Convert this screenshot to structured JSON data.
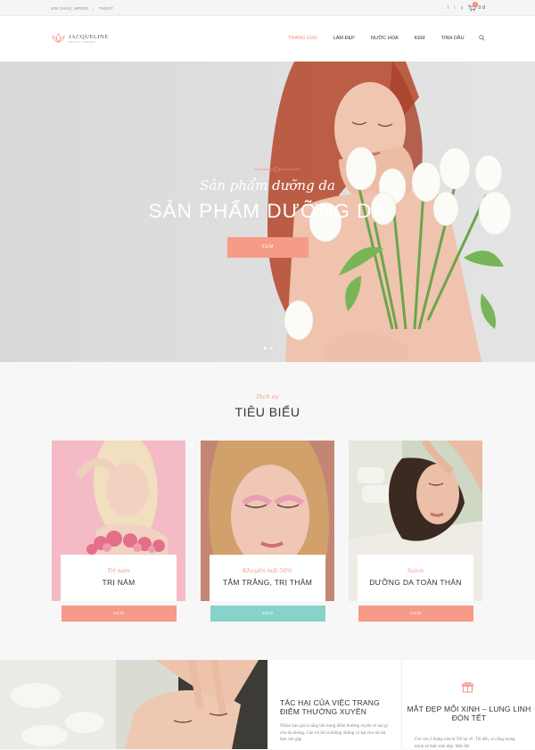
{
  "topbar": {
    "greeting": "XIN CHÀO, MP002",
    "logout": "THOÁT",
    "social_icons": [
      "facebook-icon",
      "twitter-icon",
      "pinterest-icon"
    ],
    "social_glyphs": [
      "f",
      "t",
      "p"
    ],
    "cart_count": "0",
    "cart_total": "0 đ"
  },
  "header": {
    "brand": "JACQUELINE",
    "tagline": "BEAUTY THERAPY",
    "nav": [
      {
        "label": "TRANG CHỦ",
        "active": true
      },
      {
        "label": "LÀM ĐẸP",
        "active": false
      },
      {
        "label": "NƯỚC HOA",
        "active": false
      },
      {
        "label": "KEM",
        "active": false
      },
      {
        "label": "TINH DẦU",
        "active": false
      }
    ]
  },
  "hero": {
    "script": "Sản phẩm dưỡng da",
    "title": "SẢN PHẨM DƯỠNG DA",
    "button": "XEM",
    "slides": 2,
    "active_slide": 1
  },
  "services": {
    "subtitle": "Dịch vụ",
    "title": "TIÊU BIỂU",
    "cards": [
      {
        "sub": "Trị nám",
        "name": "TRỊ NÁM",
        "button": "XEM",
        "button_color": "#f59b88"
      },
      {
        "sub": "Khuyến mãi 50%",
        "name": "TẮM TRẮNG, TRỊ THÂM",
        "button": "XEM",
        "button_color": "#86d3c9"
      },
      {
        "sub": "Salon",
        "name": "DƯỠNG DA TOÀN THÂN",
        "button": "XEM",
        "button_color": "#f59b88"
      }
    ]
  },
  "bottom": {
    "post_title": "TÁC HẠI CỦA VIỆC TRANG ĐIỂM THƯỜNG XUYÊN",
    "post_text": "Nhiều bạn gái lo lắng khi trang điểm thường xuyên có hại gì cho da không. Câu trả lời là không những có hại cho da mà bạn còn gặp",
    "promo_title": "MẮT ĐẸP MỖI XINH – LUNG LINH ĐÓN TẾT",
    "promo_text": "Chỉ còn 2 tháng nữa là Tết lại về. Tết đến, ai cũng mong mình sẽ thật xinh đẹp. Một đôi"
  },
  "colors": {
    "accent": "#f28c7a",
    "button_coral": "#f59b88",
    "button_teal": "#86d3c9"
  }
}
